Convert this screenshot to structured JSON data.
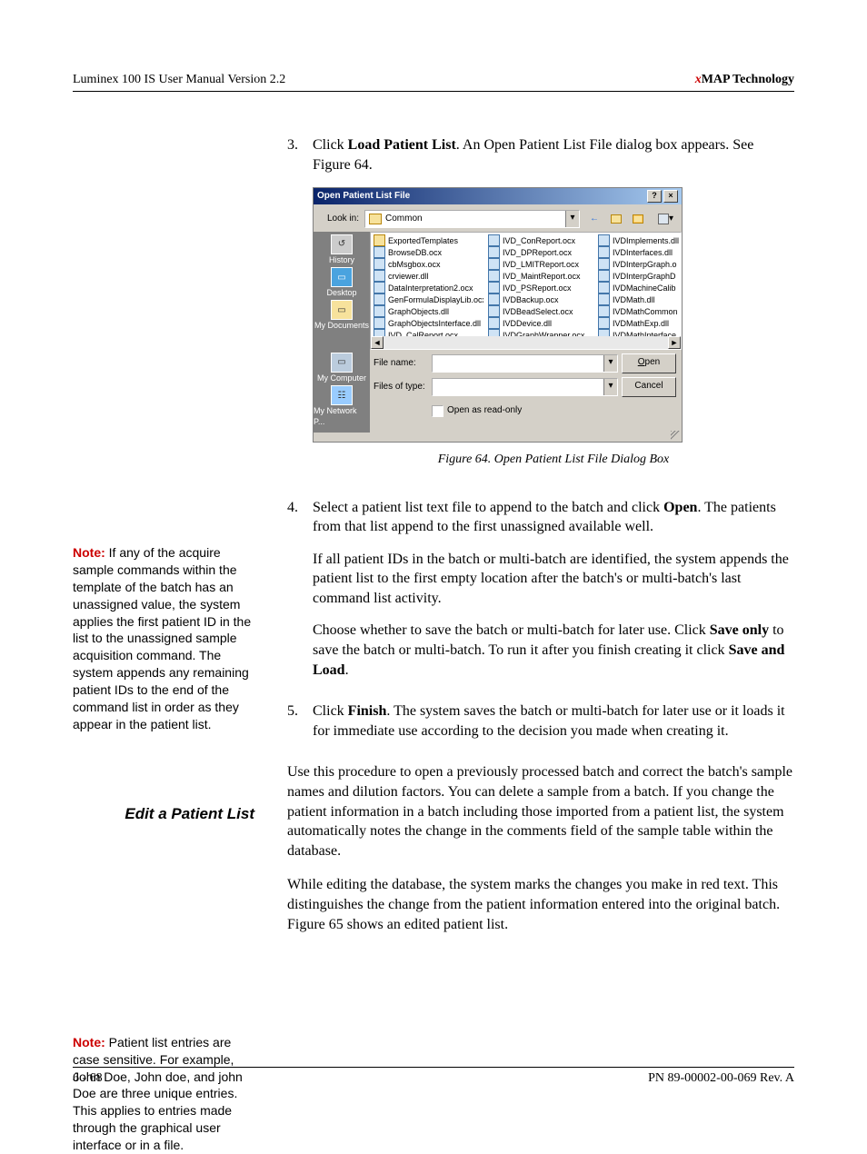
{
  "header": {
    "left": "Luminex 100 IS User Manual Version 2.2",
    "right_prefix": "x",
    "right_rest": "MAP Technology"
  },
  "steps": {
    "s3": {
      "num": "3.",
      "t1a": "Click ",
      "t1b": "Load Patient List",
      "t1c": ". An Open Patient List File dialog box appears. See Figure 64."
    },
    "s4": {
      "num": "4.",
      "p1a": "Select a patient list text file to append to the batch and click ",
      "p1b": "Open",
      "p1c": ". The patients from that list append to the first unassigned available well.",
      "p2": "If all patient IDs in the batch or multi-batch are identified, the system appends the patient list to the first empty location after the batch's or multi-batch's last command list activity.",
      "p3a": "Choose whether to save the batch or multi-batch for later use. Click ",
      "p3b": "Save only",
      "p3c": " to save the batch or multi-batch. To run it after you finish creating it click ",
      "p3d": "Save and Load",
      "p3e": "."
    },
    "s5": {
      "num": "5.",
      "t1a": "Click ",
      "t1b": "Finish",
      "t1c": ". The system saves the batch or multi-batch for later use or it loads it for immediate use according to the decision you made when creating it."
    }
  },
  "figcaption": "Figure 64.  Open Patient List File Dialog Box",
  "sideheading": "Edit a Patient List",
  "editpara1": "Use this procedure to open a previously processed batch and correct the batch's sample names and dilution factors. You can delete a sample from a batch. If you change the patient information in a batch including those imported from a patient list, the system automatically notes the change in the comments field of the sample table within the database.",
  "editpara2": "While editing the database, the system marks the changes you make in red text. This distinguishes the change from the patient information entered into the original batch. Figure 65 shows an edited patient list.",
  "note1": {
    "label": "Note:",
    "text": " If any of the acquire sample commands within the template of the batch has an unassigned value, the system applies the first patient ID in the list to the unassigned sample acquisition command. The system appends any remaining patient IDs to the end of the command list in order as they appear in the patient list."
  },
  "note2": {
    "label": "Note:",
    "text": " Patient list entries are case sensitive. For example, John Doe, John doe, and john Doe are three unique entries. This applies to entries made through the graphical user interface or in a file."
  },
  "dialog": {
    "title": "Open Patient List File",
    "help": "?",
    "close": "×",
    "lookin_label": "Look in:",
    "lookin_value": "Common",
    "back": "←",
    "up_icon": "up-one-level-icon",
    "newfolder_icon": "new-folder-icon",
    "views_icon": "views-icon",
    "views_caret": "▾",
    "places": [
      "History",
      "Desktop",
      "My Documents",
      "My Computer",
      "My Network P..."
    ],
    "file_cols": [
      [
        {
          "n": "ExportedTemplates",
          "folder": true
        },
        {
          "n": "BrowseDB.ocx"
        },
        {
          "n": "cbMsgbox.ocx"
        },
        {
          "n": "crviewer.dll"
        },
        {
          "n": "DataInterpretation2.ocx"
        },
        {
          "n": "GenFormulaDisplayLib.ocx"
        },
        {
          "n": "GraphObjects.dll"
        },
        {
          "n": "GraphObjectsInterface.dll"
        },
        {
          "n": "IVD_CalReport.ocx"
        }
      ],
      [
        {
          "n": "IVD_ConReport.ocx"
        },
        {
          "n": "IVD_DPReport.ocx"
        },
        {
          "n": "IVD_LMITReport.ocx"
        },
        {
          "n": "IVD_MaintReport.ocx"
        },
        {
          "n": "IVD_PSReport.ocx"
        },
        {
          "n": "IVDBackup.ocx"
        },
        {
          "n": "IVDBeadSelect.ocx"
        },
        {
          "n": "IVDDevice.dll"
        },
        {
          "n": "IVDGraphWrapper.ocx"
        }
      ],
      [
        {
          "n": "IVDImplements.dll"
        },
        {
          "n": "IVDInterfaces.dll"
        },
        {
          "n": "IVDInterpGraph.o"
        },
        {
          "n": "IVDInterpGraphD"
        },
        {
          "n": "IVDMachineCalib"
        },
        {
          "n": "IVDMath.dll"
        },
        {
          "n": "IVDMathCommon"
        },
        {
          "n": "IVDMathExp.dll"
        },
        {
          "n": "IVDMathInterface"
        }
      ]
    ],
    "scroll_left": "◄",
    "scroll_right": "►",
    "filename_label": "File name:",
    "filetype_label": "Files of type:",
    "open_btn": "Open",
    "cancel_btn": "Cancel",
    "readonly": "Open as read-only"
  },
  "footer": {
    "left": "6 - 68",
    "right": "PN 89-00002-00-069 Rev. A"
  }
}
